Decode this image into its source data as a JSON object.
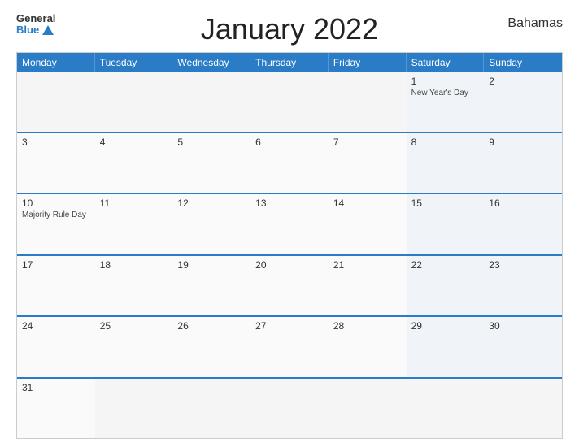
{
  "header": {
    "logo_general": "General",
    "logo_blue": "Blue",
    "title": "January 2022",
    "country": "Bahamas"
  },
  "calendar": {
    "days_of_week": [
      "Monday",
      "Tuesday",
      "Wednesday",
      "Thursday",
      "Friday",
      "Saturday",
      "Sunday"
    ],
    "weeks": [
      [
        {
          "day": "",
          "event": "",
          "type": "empty"
        },
        {
          "day": "",
          "event": "",
          "type": "empty"
        },
        {
          "day": "",
          "event": "",
          "type": "empty"
        },
        {
          "day": "",
          "event": "",
          "type": "empty"
        },
        {
          "day": "",
          "event": "",
          "type": "empty"
        },
        {
          "day": "1",
          "event": "New Year's Day",
          "type": "weekend"
        },
        {
          "day": "2",
          "event": "",
          "type": "weekend"
        }
      ],
      [
        {
          "day": "3",
          "event": "",
          "type": "weekday"
        },
        {
          "day": "4",
          "event": "",
          "type": "weekday"
        },
        {
          "day": "5",
          "event": "",
          "type": "weekday"
        },
        {
          "day": "6",
          "event": "",
          "type": "weekday"
        },
        {
          "day": "7",
          "event": "",
          "type": "weekday"
        },
        {
          "day": "8",
          "event": "",
          "type": "weekend"
        },
        {
          "day": "9",
          "event": "",
          "type": "weekend"
        }
      ],
      [
        {
          "day": "10",
          "event": "Majority Rule Day",
          "type": "weekday"
        },
        {
          "day": "11",
          "event": "",
          "type": "weekday"
        },
        {
          "day": "12",
          "event": "",
          "type": "weekday"
        },
        {
          "day": "13",
          "event": "",
          "type": "weekday"
        },
        {
          "day": "14",
          "event": "",
          "type": "weekday"
        },
        {
          "day": "15",
          "event": "",
          "type": "weekend"
        },
        {
          "day": "16",
          "event": "",
          "type": "weekend"
        }
      ],
      [
        {
          "day": "17",
          "event": "",
          "type": "weekday"
        },
        {
          "day": "18",
          "event": "",
          "type": "weekday"
        },
        {
          "day": "19",
          "event": "",
          "type": "weekday"
        },
        {
          "day": "20",
          "event": "",
          "type": "weekday"
        },
        {
          "day": "21",
          "event": "",
          "type": "weekday"
        },
        {
          "day": "22",
          "event": "",
          "type": "weekend"
        },
        {
          "day": "23",
          "event": "",
          "type": "weekend"
        }
      ],
      [
        {
          "day": "24",
          "event": "",
          "type": "weekday"
        },
        {
          "day": "25",
          "event": "",
          "type": "weekday"
        },
        {
          "day": "26",
          "event": "",
          "type": "weekday"
        },
        {
          "day": "27",
          "event": "",
          "type": "weekday"
        },
        {
          "day": "28",
          "event": "",
          "type": "weekday"
        },
        {
          "day": "29",
          "event": "",
          "type": "weekend"
        },
        {
          "day": "30",
          "event": "",
          "type": "weekend"
        }
      ],
      [
        {
          "day": "31",
          "event": "",
          "type": "weekday"
        },
        {
          "day": "",
          "event": "",
          "type": "empty"
        },
        {
          "day": "",
          "event": "",
          "type": "empty"
        },
        {
          "day": "",
          "event": "",
          "type": "empty"
        },
        {
          "day": "",
          "event": "",
          "type": "empty"
        },
        {
          "day": "",
          "event": "",
          "type": "empty"
        },
        {
          "day": "",
          "event": "",
          "type": "empty"
        }
      ]
    ]
  }
}
